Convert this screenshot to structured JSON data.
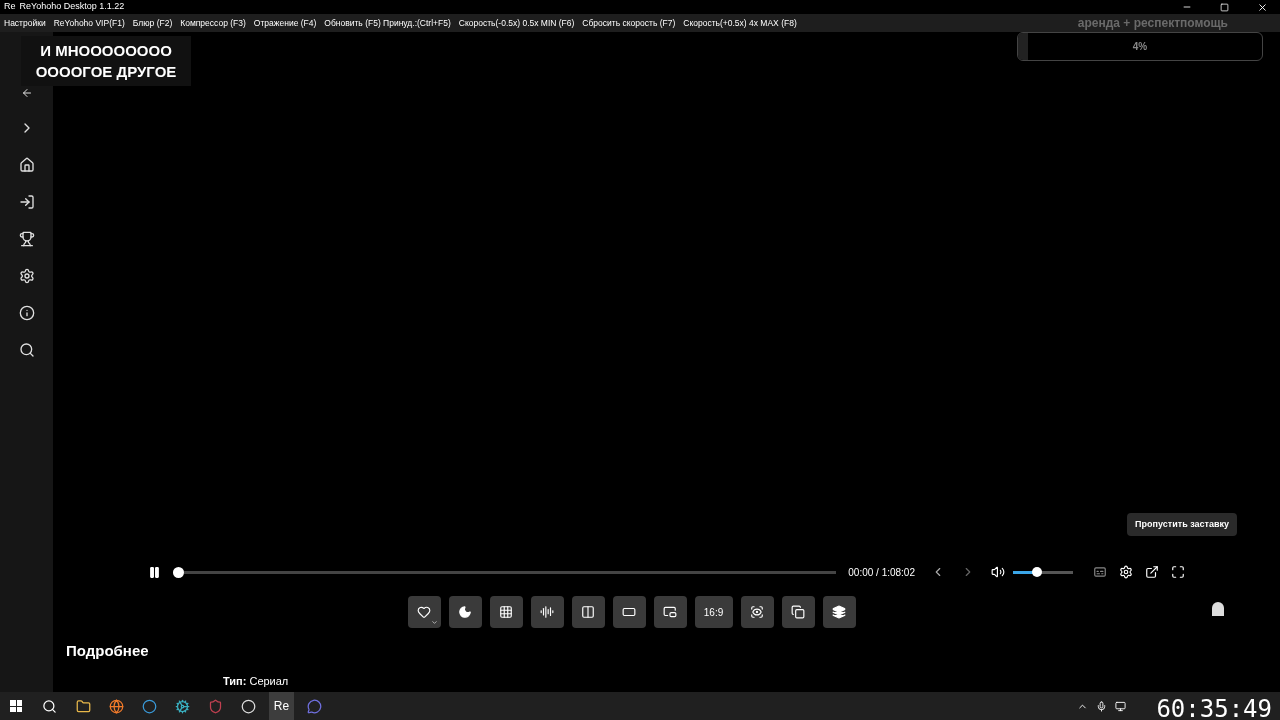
{
  "window": {
    "title": "ReYohoho Desktop 1.1.22",
    "logo": "Re"
  },
  "menu": [
    "Настройки",
    "ReYohoho VIP(F1)",
    "Блюр (F2)",
    "Компрессор (F3)",
    "Отражение (F4)",
    "Обновить (F5) Принуд.:(Ctrl+F5)",
    "Скорость(-0.5x) 0.5x MIN (F6)",
    "Сбросить скорость (F7)",
    "Скорость(+0.5x) 4x MAX (F8)"
  ],
  "overlay": {
    "caption": "И МНОООООООО ООООГОЕ ДРУГОЕ",
    "goal_title": "аренда + респектпомощь",
    "goal": {
      "level": 0.04,
      "reading": "4%"
    },
    "timer": "60:35:49"
  },
  "player": {
    "playing": true,
    "progress": {
      "level": 0.0
    },
    "time": "00:00 / 1:08:02",
    "volume": {
      "level": 0.4
    },
    "tooltip": "Пропустить заставку"
  },
  "toolbar": [
    {
      "kind": "heart"
    },
    {
      "kind": "moon"
    },
    {
      "kind": "grid"
    },
    {
      "kind": "wave"
    },
    {
      "kind": "split"
    },
    {
      "kind": "aspect"
    },
    {
      "kind": "pip"
    },
    {
      "kind": "text",
      "label": "16:9"
    },
    {
      "kind": "focus"
    },
    {
      "kind": "copy"
    },
    {
      "kind": "layers"
    }
  ],
  "details": {
    "heading": "Подробнее",
    "type_line": "**Тип:** Сериал"
  },
  "taskbar": {
    "apps": [
      {
        "kind": "folder",
        "selected": false
      },
      {
        "kind": "firefox",
        "selected": false
      },
      {
        "kind": "c",
        "selected": false
      },
      {
        "kind": "gear",
        "selected": false
      },
      {
        "kind": "shield",
        "selected": false
      },
      {
        "kind": "obs",
        "selected": false
      },
      {
        "kind": "re",
        "label": "Re",
        "selected": true
      },
      {
        "kind": "chat",
        "selected": false
      }
    ]
  }
}
